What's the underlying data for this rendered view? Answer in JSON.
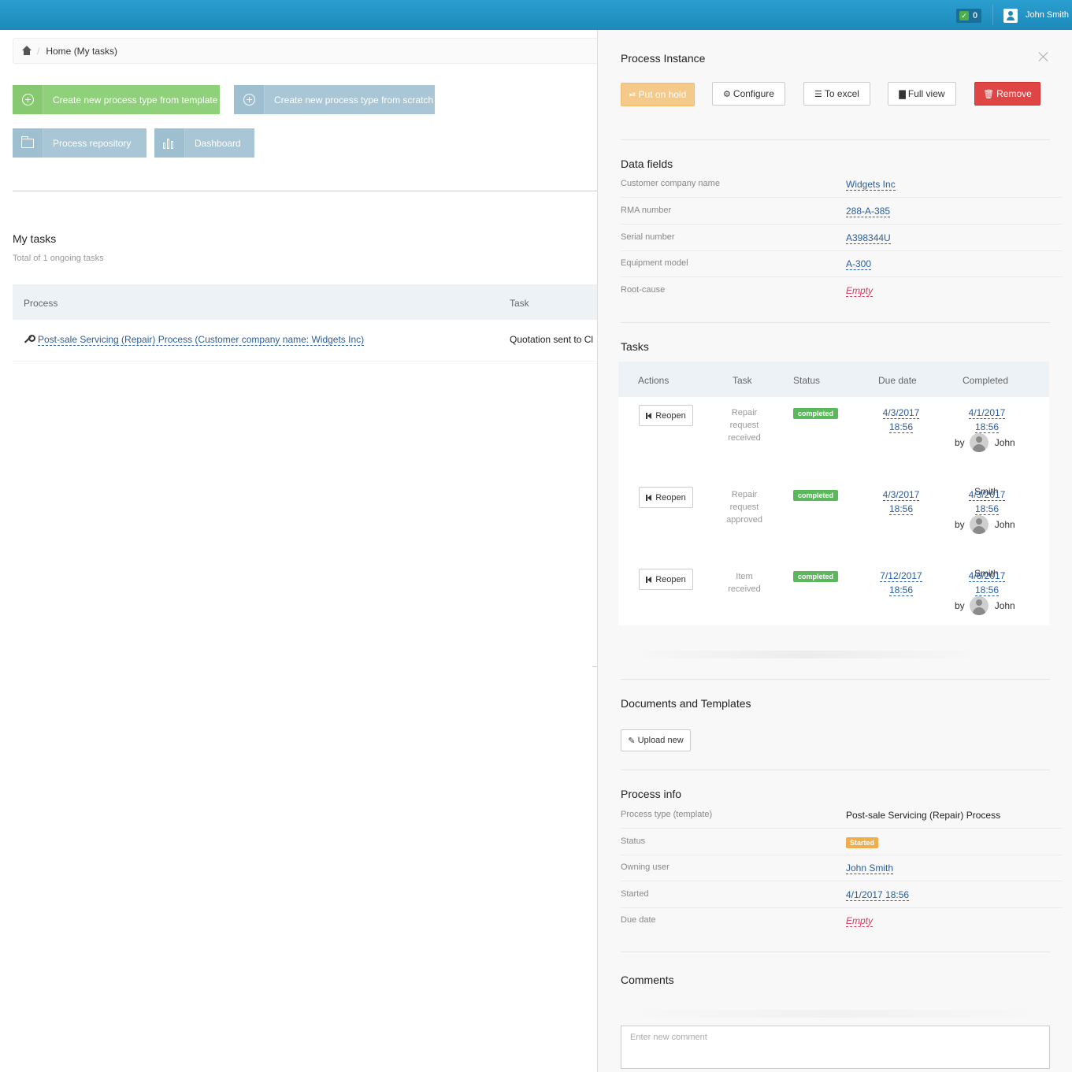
{
  "topbar": {
    "notif_count": "0",
    "user_name": "John Smith"
  },
  "breadcrumb": {
    "separator": "/",
    "current": "Home (My tasks)"
  },
  "tiles": [
    {
      "label": "Create new process type from template",
      "color": "#8fd07a"
    },
    {
      "label": "Create new process type from scratch",
      "color": "#a8c6d6"
    },
    {
      "label": "Process repository",
      "color": "#a8c6d6"
    },
    {
      "label": "Dashboard",
      "color": "#a8c6d6"
    }
  ],
  "my_tasks": {
    "title": "My tasks",
    "subtitle": "Total of 1 ongoing tasks",
    "columns": [
      "Process",
      "Task"
    ],
    "rows": [
      {
        "process": "Post-sale Servicing (Repair) Process (Customer company name: Widgets Inc)",
        "task": "Quotation sent to Cl"
      }
    ]
  },
  "panel": {
    "title": "Process Instance",
    "buttons": {
      "hold": "Put on hold",
      "configure": "Configure",
      "excel": "To excel",
      "full_view": "Full view",
      "remove": "Remove"
    },
    "data_fields": {
      "title": "Data fields",
      "rows": [
        {
          "key": "Customer company name",
          "value": "Widgets Inc"
        },
        {
          "key": "RMA number",
          "value": "288-A-385"
        },
        {
          "key": "Serial number",
          "value": "A398344U"
        },
        {
          "key": "Equipment model",
          "value": "A-300"
        },
        {
          "key": "Root-cause",
          "value": "Empty"
        }
      ]
    },
    "tasks": {
      "title": "Tasks",
      "columns": [
        "Actions",
        "Task",
        "Status",
        "Due date",
        "Completed"
      ],
      "reopen_label": "Reopen",
      "by_label": "by",
      "rows": [
        {
          "task_line1": "Repair",
          "task_line2": "request",
          "task_line3": "received",
          "status": "completed",
          "due_date": "4/3/2017",
          "due_time": "18:56",
          "completed_date": "4/1/2017",
          "completed_time": "18:56",
          "user_first": "John",
          "user_last": "Smith"
        },
        {
          "task_line1": "Repair",
          "task_line2": "request",
          "task_line3": "approved",
          "status": "completed",
          "due_date": "4/3/2017",
          "due_time": "18:56",
          "completed_date": "4/3/2017",
          "completed_time": "18:56",
          "user_first": "John",
          "user_last": "Smith"
        },
        {
          "task_line1": "Item",
          "task_line2": "received",
          "task_line3": "",
          "status": "completed",
          "due_date": "7/12/2017",
          "due_time": "18:56",
          "completed_date": "4/6/2017",
          "completed_time": "18:56",
          "user_first": "John",
          "user_last": ""
        }
      ]
    },
    "documents": {
      "title": "Documents and Templates",
      "upload_label": "Upload new"
    },
    "process_info": {
      "title": "Process info",
      "type_key": "Process type (template)",
      "type_value": "Post-sale Servicing (Repair) Process",
      "status_key": "Status",
      "status_value": "Started",
      "owner_key": "Owning user",
      "owner_value": "John Smith",
      "started_key": "Started",
      "started_value": "4/1/2017 18:56",
      "due_key": "Due date",
      "due_value": "Empty"
    },
    "comments": {
      "title": "Comments",
      "placeholder": "Enter new comment"
    }
  },
  "colors": {
    "topbar": "#1c89ba",
    "link": "#2a5d9e",
    "empty": "#d63b5b",
    "completed": "#5cb85c",
    "started": "#f0ad4e",
    "remove": "#e04545"
  }
}
